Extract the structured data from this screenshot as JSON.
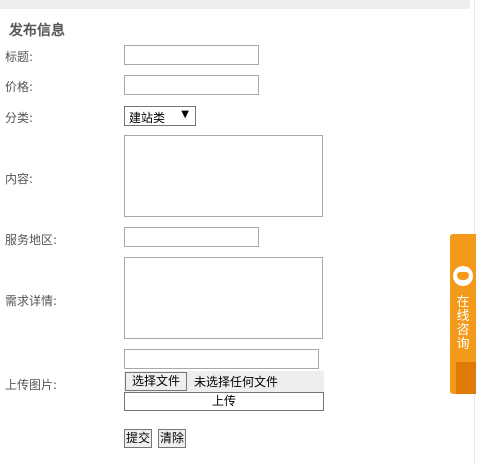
{
  "form": {
    "title": "发布信息",
    "labels": {
      "title": "标题:",
      "price": "价格:",
      "category": "分类:",
      "content": "内容:",
      "service_area": "服务地区:",
      "requirements": "需求详情:",
      "upload_image": "上传图片:"
    },
    "category_select": {
      "selected": "建站类"
    },
    "file_input": {
      "button_label": "选择文件",
      "status": "未选择任何文件"
    },
    "upload_button": "上传",
    "submit_button": "提交",
    "reset_button": "清除"
  },
  "side_widget": {
    "text": "在线咨询",
    "icon": "chat-agent-icon",
    "color": "#f39a1a"
  }
}
